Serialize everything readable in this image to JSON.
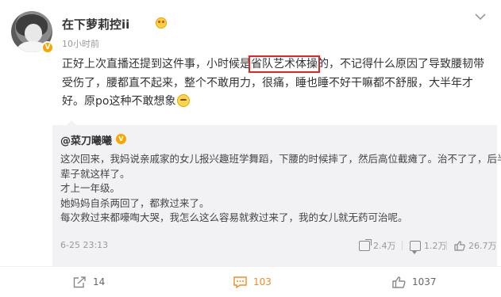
{
  "post": {
    "username": "在下萝莉控ii",
    "time": "10小时前",
    "text_lines": [
      [
        "正好上次直播还提到这件事，小时候是",
        "省队艺术体操",
        "的，不记得什么原因了导致腰韧带"
      ],
      "受伤了，腰都直不起来，整个不敢用力，很痛，睡也睡不好干嘛都不舒服，大半年才",
      "好。原po这种不敢想象"
    ],
    "highlight_color": "#e52423"
  },
  "repost": {
    "author": "@菜刀曦曦",
    "lines": [
      "这次回来，我妈说亲戚家的女儿报兴趣班学舞蹈，下腰的时候摔了，然后高位截瘫了。治不了了，后半",
      "辈子就这样了。",
      "才上一年级。",
      "她妈妈自杀两回了，都救过来了。",
      "每次救过来都嚎啕大哭，我怎么这么容易就救过来了，我的女儿就无药可治呢。"
    ],
    "date": "6-25 23:13",
    "stats": {
      "share": "2.4万",
      "comment": "1.2万",
      "like": "26.7万"
    }
  },
  "actions": {
    "share": "14",
    "comment": "103",
    "like": "1037",
    "comment_color": "#f28b24"
  },
  "icons": {
    "more": "chevron-down-icon",
    "share": "share-icon",
    "comment": "comment-icon",
    "like": "thumbs-up-icon"
  }
}
